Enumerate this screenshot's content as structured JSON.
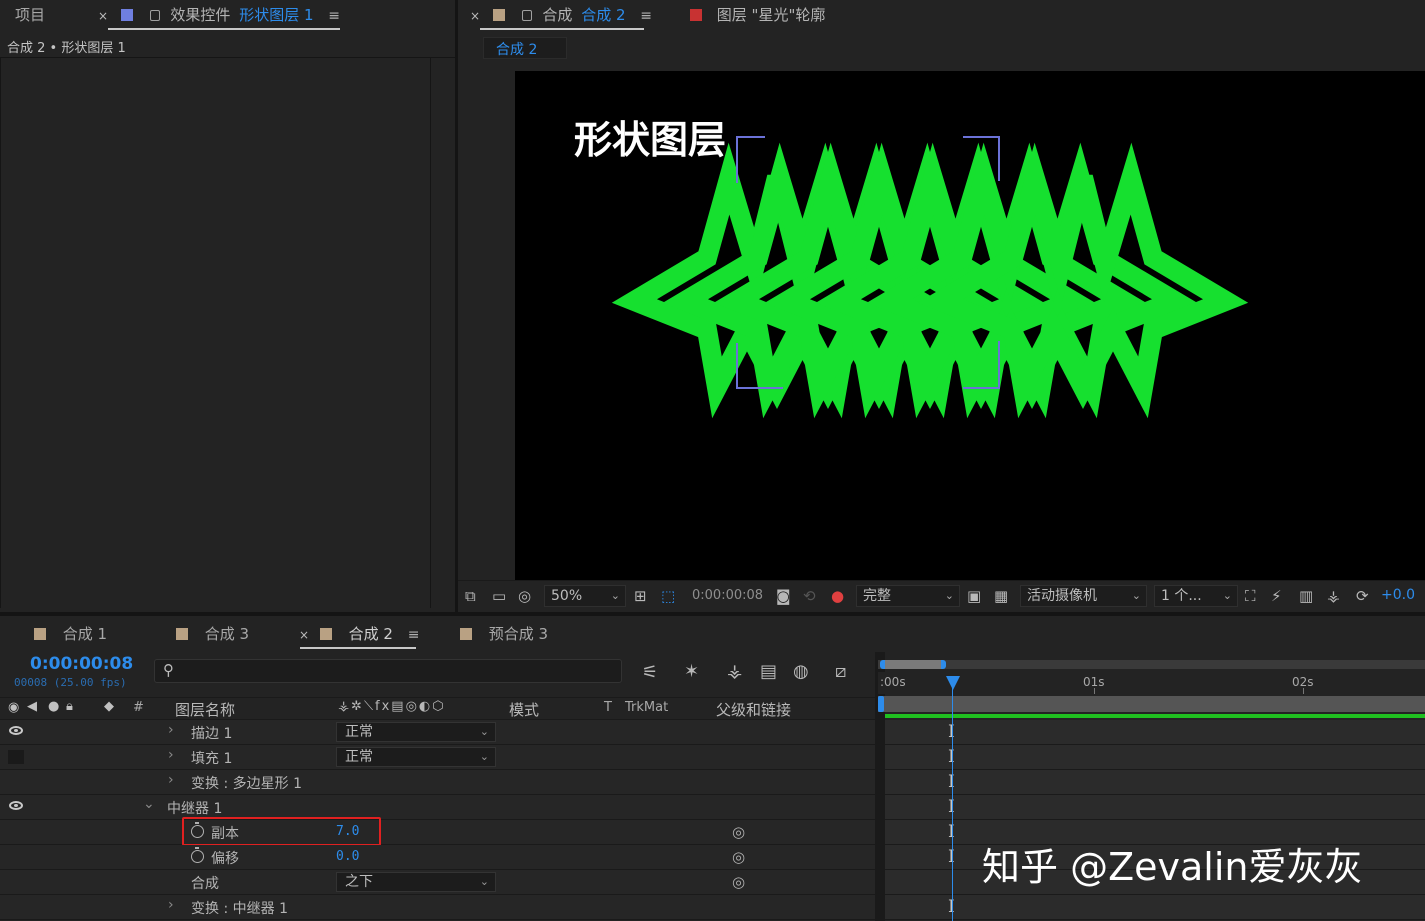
{
  "top_left": {
    "tab_project": "项目",
    "tab_effects_prefix": "效果控件",
    "tab_effects_layer": "形状图层 1",
    "breadcrumb": "合成 2 • 形状图层 1"
  },
  "viewer": {
    "tab_comp_prefix": "合成",
    "tab_comp_name": "合成 2",
    "tab_layer": "图层 \"星光\"轮廓",
    "subtab": "合成 2",
    "overlay_text": "形状图层",
    "zoom": "50%",
    "timecode": "0:00:00:08",
    "resolution": "完整",
    "camera": "活动摄像机",
    "views": "1 个...",
    "exposure": "+0.0",
    "shape_color": "#16e02f"
  },
  "timeline": {
    "tabs": [
      "合成 1",
      "合成 3",
      "合成 2",
      "预合成 3"
    ],
    "timecode": "0:00:00:08",
    "frame_info": "00008 (25.00 fps)",
    "search_placeholder": "",
    "headers": {
      "num": "#",
      "layer_name": "图层名称",
      "mode": "模式",
      "t": "T",
      "trkmat": "TrkMat",
      "parent": "父级和链接"
    },
    "ruler": {
      "t0": ":00s",
      "t1": "01s",
      "t2": "02s"
    },
    "rows": [
      {
        "label": "描边 1",
        "mode": "正常"
      },
      {
        "label": "填充 1",
        "mode": "正常"
      },
      {
        "label": "变换 : 多边星形 1"
      },
      {
        "label": "中继器 1"
      },
      {
        "label": "副本",
        "value": "7.0"
      },
      {
        "label": "偏移",
        "value": "0.0"
      },
      {
        "label": "合成",
        "mode": "之下"
      },
      {
        "label": "变换 : 中继器 1"
      }
    ]
  },
  "watermark": "知乎 @Zevalin爱灰灰",
  "colors": {
    "accent": "#2d8ceb",
    "highlight_box": "#e02020",
    "green_bar": "#20c020"
  }
}
